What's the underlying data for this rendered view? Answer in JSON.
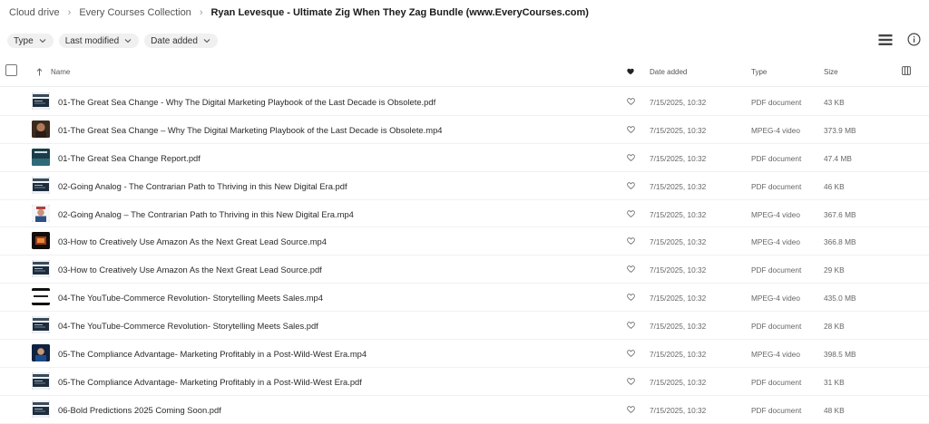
{
  "breadcrumb": {
    "items": [
      "Cloud drive",
      "Every Courses Collection"
    ],
    "current": "Ryan Levesque - Ultimate Zig When They Zag Bundle (www.EveryCourses.com)"
  },
  "filters": [
    {
      "label": "Type"
    },
    {
      "label": "Last modified"
    },
    {
      "label": "Date added"
    }
  ],
  "columns": {
    "name": "Name",
    "date": "Date added",
    "type": "Type",
    "size": "Size"
  },
  "files": [
    {
      "name": "01-The Great Sea Change - Why The Digital Marketing Playbook of the Last Decade is Obsolete.pdf",
      "date": "7/15/2025, 10:32",
      "type": "PDF document",
      "size": "43 KB",
      "thumb": "pdf"
    },
    {
      "name": "01-The Great Sea Change – Why The Digital Marketing Playbook of the Last Decade is Obsolete.mp4",
      "date": "7/15/2025, 10:32",
      "type": "MPEG-4 video",
      "size": "373.9 MB",
      "thumb": "face"
    },
    {
      "name": "01-The Great Sea Change Report.pdf",
      "date": "7/15/2025, 10:32",
      "type": "PDF document",
      "size": "47.4 MB",
      "thumb": "report"
    },
    {
      "name": "02-Going Analog - The Contrarian Path to Thriving in this New Digital Era.pdf",
      "date": "7/15/2025, 10:32",
      "type": "PDF document",
      "size": "46 KB",
      "thumb": "pdf"
    },
    {
      "name": "02-Going Analog – The Contrarian Path to Thriving in this New Digital Era.mp4",
      "date": "7/15/2025, 10:32",
      "type": "MPEG-4 video",
      "size": "367.6 MB",
      "thumb": "person"
    },
    {
      "name": "03-How to Creatively Use Amazon As the Next Great Lead Source.mp4",
      "date": "7/15/2025, 10:32",
      "type": "MPEG-4 video",
      "size": "366.8 MB",
      "thumb": "video-dark"
    },
    {
      "name": "03-How to Creatively Use Amazon As the Next Great Lead Source.pdf",
      "date": "7/15/2025, 10:32",
      "type": "PDF document",
      "size": "29 KB",
      "thumb": "pdf"
    },
    {
      "name": "04-The YouTube-Commerce Revolution- Storytelling Meets Sales.mp4",
      "date": "7/15/2025, 10:32",
      "type": "MPEG-4 video",
      "size": "435.0 MB",
      "thumb": "video-white"
    },
    {
      "name": "04-The YouTube-Commerce Revolution- Storytelling Meets Sales.pdf",
      "date": "7/15/2025, 10:32",
      "type": "PDF document",
      "size": "28 KB",
      "thumb": "pdf"
    },
    {
      "name": "05-The Compliance Advantage- Marketing Profitably in a Post-Wild-West Era.mp4",
      "date": "7/15/2025, 10:32",
      "type": "MPEG-4 video",
      "size": "398.5 MB",
      "thumb": "video-blue"
    },
    {
      "name": "05-The Compliance Advantage- Marketing Profitably in a Post-Wild-West Era.pdf",
      "date": "7/15/2025, 10:32",
      "type": "PDF document",
      "size": "31 KB",
      "thumb": "pdf"
    },
    {
      "name": "06-Bold Predictions 2025 Coming Soon.pdf",
      "date": "7/15/2025, 10:32",
      "type": "PDF document",
      "size": "48 KB",
      "thumb": "pdf"
    }
  ]
}
